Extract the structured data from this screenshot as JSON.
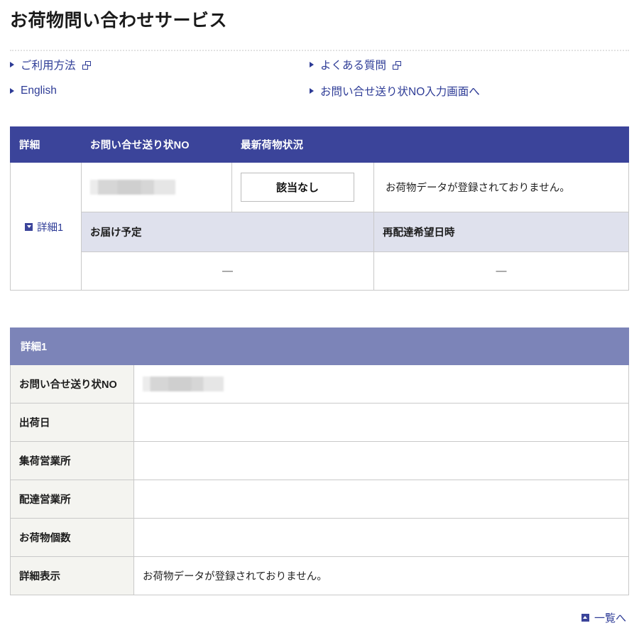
{
  "page": {
    "title": "お荷物問い合わせサービス"
  },
  "nav": {
    "links": [
      {
        "label": "ご利用方法",
        "external": true,
        "icon": "external-link-icon"
      },
      {
        "label": "よくある質問",
        "external": true,
        "icon": "external-link-icon"
      },
      {
        "label": "English",
        "external": false,
        "icon": ""
      },
      {
        "label": "お問い合せ送り状NO入力画面へ",
        "external": false,
        "icon": ""
      }
    ]
  },
  "tracking_table": {
    "headers": [
      "詳細",
      "お問い合せ送り状NO",
      "最新荷物状況"
    ],
    "row": {
      "detail_link_label": "詳細1",
      "detail_link_icon": "square-down-triangle-icon",
      "waybill_no": "",
      "waybill_masked": true,
      "status_badge": "該当なし",
      "message": "お荷物データが登録されておりません。"
    },
    "sub_headers": [
      "お届け予定",
      "再配達希望日時"
    ],
    "sub_values": [
      "—",
      "—"
    ]
  },
  "detail_panel": {
    "title": "詳細1",
    "rows": [
      {
        "label": "お問い合せ送り状NO",
        "value": "",
        "masked": true
      },
      {
        "label": "出荷日",
        "value": "",
        "masked": false
      },
      {
        "label": "集荷営業所",
        "value": "",
        "masked": false
      },
      {
        "label": "配達営業所",
        "value": "",
        "masked": false
      },
      {
        "label": "お荷物個数",
        "value": "",
        "masked": false
      },
      {
        "label": "詳細表示",
        "value": "お荷物データが登録されておりません。",
        "masked": false
      }
    ]
  },
  "footer": {
    "back_label": "一覧へ",
    "back_icon": "square-up-triangle-icon"
  },
  "colors": {
    "header_blue": "#3b449a",
    "panel_purple": "#7c84b8",
    "subheader_lavender": "#dfe1ed",
    "label_cream": "#f4f4f0",
    "link_blue": "#2d3b96",
    "border_gray": "#c9c9c9"
  }
}
